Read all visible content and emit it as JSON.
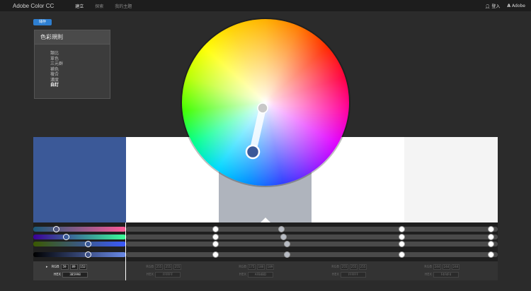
{
  "app": {
    "title": "Adobe Color CC",
    "nav": [
      "建立",
      "探索",
      "我的主題"
    ],
    "login_label": "登入",
    "adobe_label": "Adobe"
  },
  "save_label": "儲存",
  "rules": {
    "title": "色彩規則",
    "items": [
      "類比",
      "單色",
      "三元群",
      "補色",
      "複合",
      "濃度",
      "自訂"
    ],
    "selected_index": 6
  },
  "swatches": [
    {
      "color": "#3b5998"
    },
    {
      "color": "#ffffff"
    },
    {
      "color": "#afb4bd"
    },
    {
      "color": "#ffffff"
    },
    {
      "color": "#f4f4f4"
    }
  ],
  "panels": [
    {
      "rgb": [
        "59",
        "89",
        "152"
      ],
      "hex": "3B5998",
      "active": true
    },
    {
      "rgb": [
        "255",
        "255",
        "255"
      ],
      "hex": "FFFFFF",
      "active": false
    },
    {
      "rgb": [
        "175",
        "180",
        "189"
      ],
      "hex": "AFB4BD",
      "active": false
    },
    {
      "rgb": [
        "255",
        "255",
        "255"
      ],
      "hex": "FFFFFF",
      "active": false
    },
    {
      "rgb": [
        "244",
        "244",
        "244"
      ],
      "hex": "F4F4F4",
      "active": false
    }
  ],
  "labels": {
    "rgb": "RGB",
    "hex": "HEX"
  },
  "colors": {
    "accent": "#2e7fd1",
    "base": "#3b5998",
    "topbar": "#1d1d1d",
    "background": "#2b2b2b"
  }
}
